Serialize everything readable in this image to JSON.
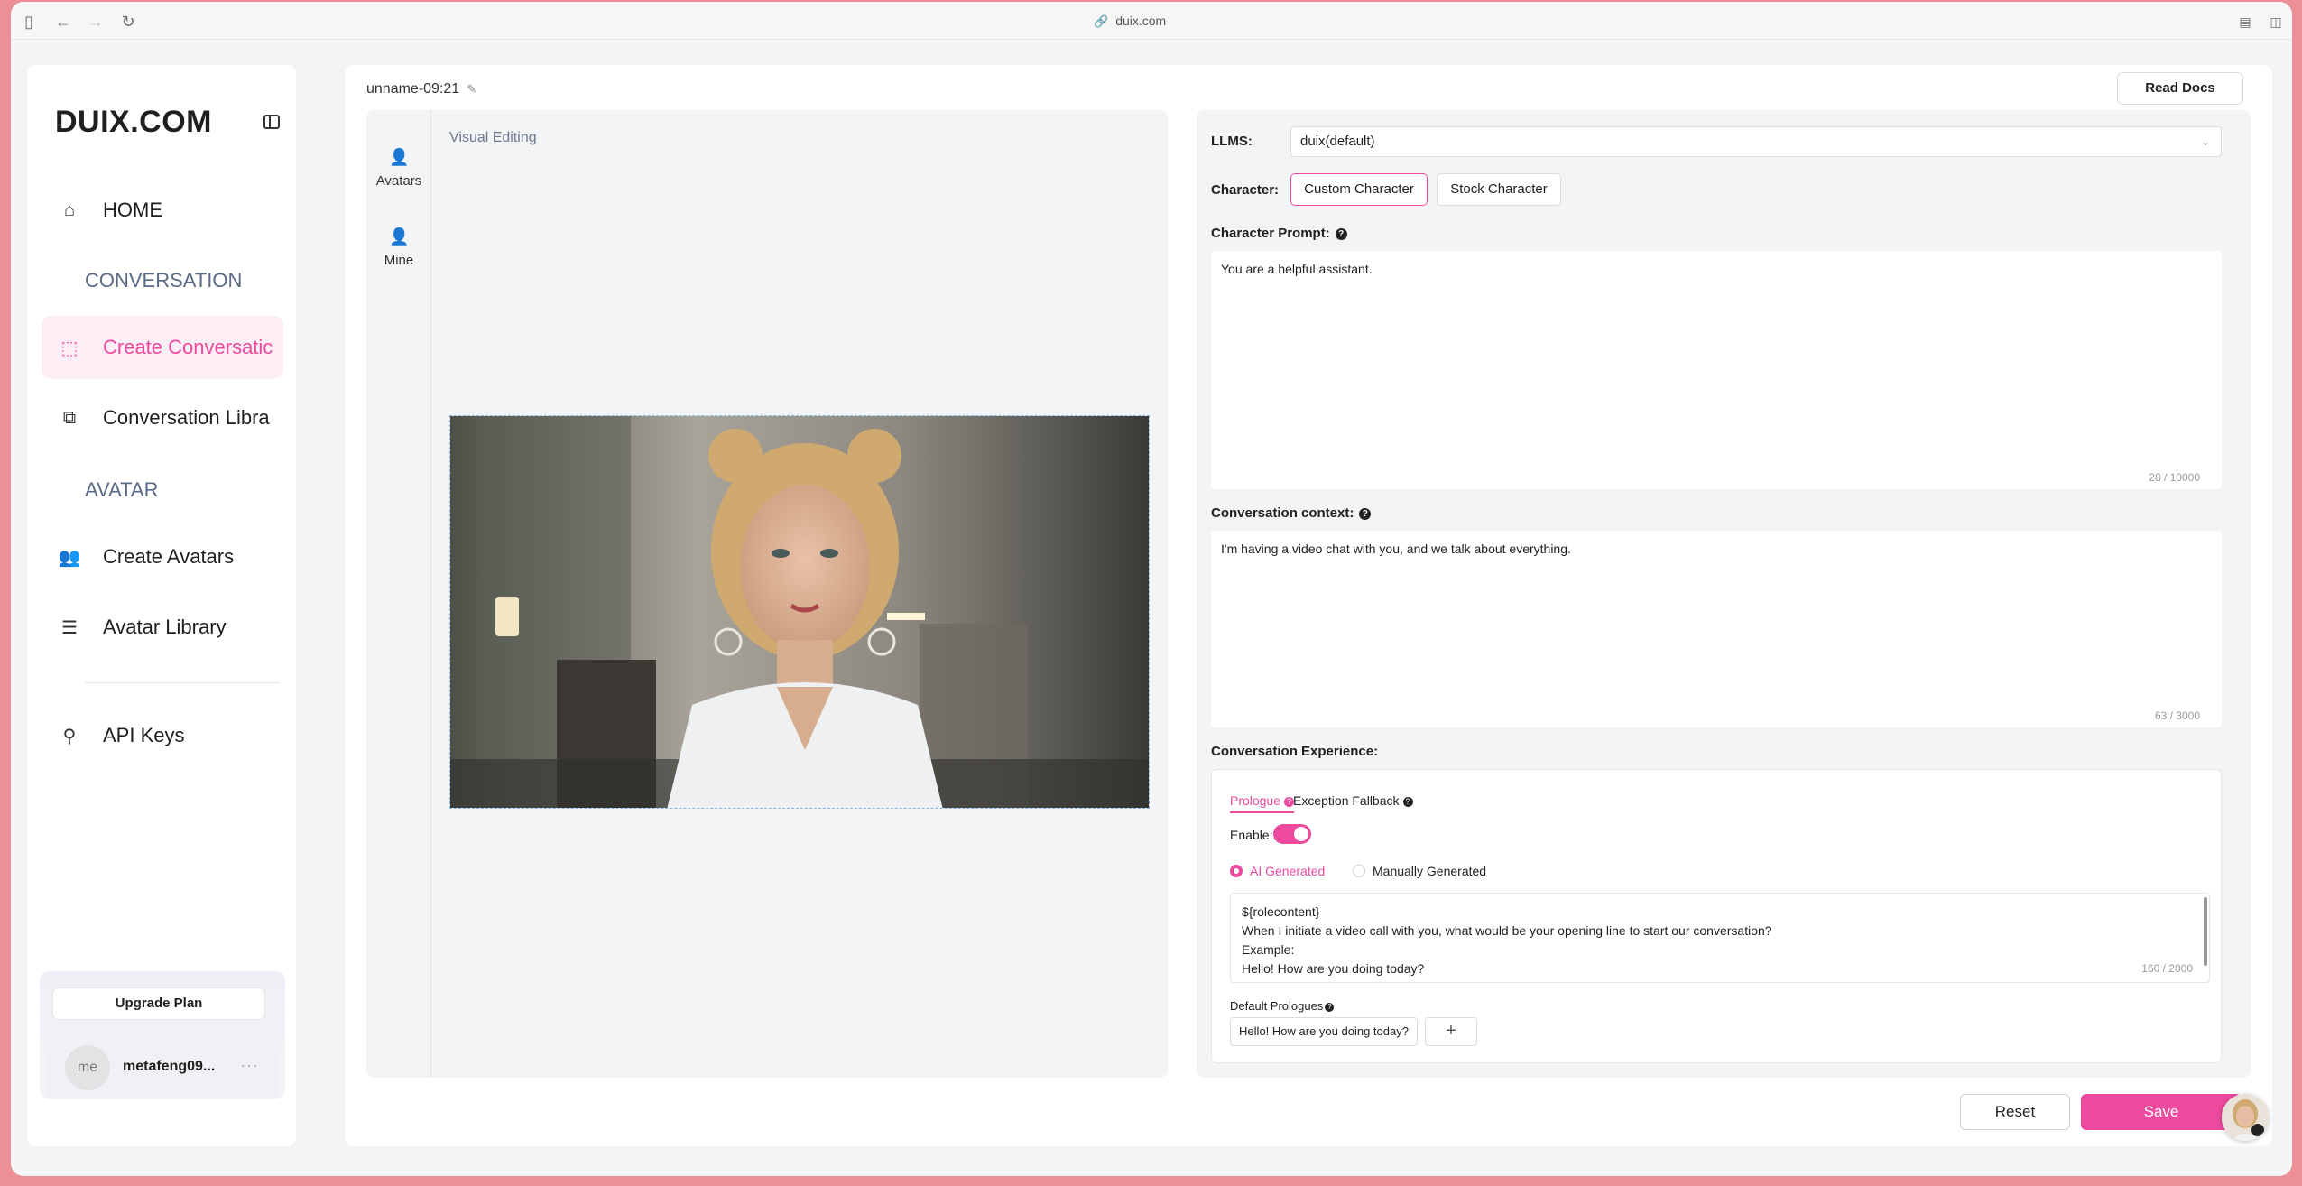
{
  "browser": {
    "url": "duix.com"
  },
  "sidebar": {
    "logo": "DUIX.COM",
    "home": "HOME",
    "section_conversation": "CONVERSATION",
    "create_conversation": "Create Conversatic",
    "conversation_library": "Conversation Libra",
    "section_avatar": "AVATAR",
    "create_avatars": "Create Avatars",
    "avatar_library": "Avatar Library",
    "api_keys": "API Keys",
    "upgrade_plan": "Upgrade Plan",
    "user_initials": "me",
    "username": "metafeng09...",
    "more": "···"
  },
  "header": {
    "conversation_name": "unname-09:21",
    "read_docs": "Read Docs"
  },
  "editor": {
    "tools": [
      {
        "label": "Avatars"
      },
      {
        "label": "Mine"
      }
    ],
    "title": "Visual Editing"
  },
  "form": {
    "llms_label": "LLMS:",
    "llms_value": "duix(default)",
    "character_label": "Character:",
    "custom_character": "Custom Character",
    "stock_character": "Stock Character",
    "prompt_label": "Character Prompt:",
    "prompt_value": "You are a helpful assistant.",
    "prompt_count": "28 / 10000",
    "context_label": "Conversation context:",
    "context_value": "I'm having a video chat with you, and we talk about everything.",
    "context_count": "63 / 3000",
    "experience_label": "Conversation Experience:",
    "tab_prologue": "Prologue",
    "tab_fallback": "Exception Fallback",
    "enable_label": "Enable:",
    "radio_ai": "AI Generated",
    "radio_manual": "Manually Generated",
    "prologue_lines": [
      "${rolecontent}",
      "When I initiate a video call with you, what would be your opening line to start our conversation?",
      "Example:",
      "Hello! How are you doing today?"
    ],
    "prologue_count": "160 / 2000",
    "default_prologues_label": "Default Prologues",
    "default_prologue_chip": "Hello! How are you doing today?",
    "add": "+"
  },
  "actions": {
    "reset": "Reset",
    "save": "Save"
  }
}
